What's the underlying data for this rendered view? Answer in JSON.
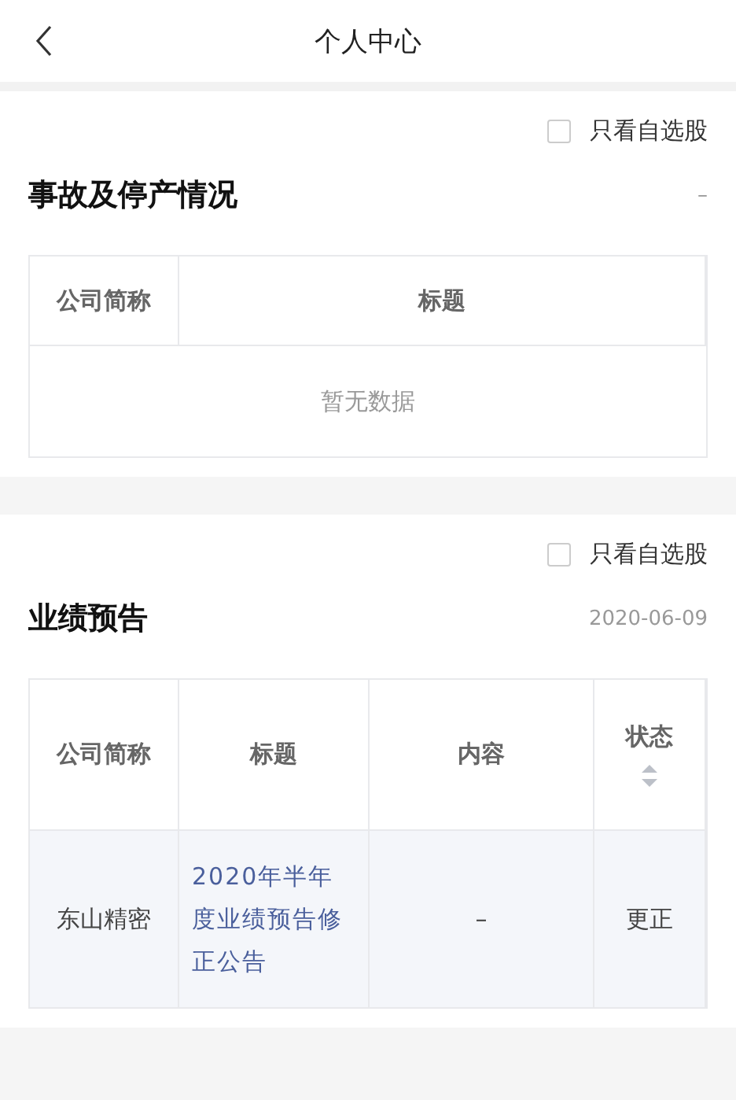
{
  "header": {
    "title": "个人中心"
  },
  "sections": [
    {
      "filter": {
        "label": "只看自选股",
        "checked": false
      },
      "title": "事故及停产情况",
      "date": "–",
      "table": {
        "columns": [
          {
            "label": "公司简称",
            "sortable": false
          },
          {
            "label": "标题",
            "sortable": false
          }
        ],
        "empty_text": "暂无数据"
      }
    },
    {
      "filter": {
        "label": "只看自选股",
        "checked": false
      },
      "title": "业绩预告",
      "date": "2020-06-09",
      "table": {
        "columns": [
          {
            "label": "公司简称",
            "sortable": false
          },
          {
            "label": "标题",
            "sortable": false
          },
          {
            "label": "内容",
            "sortable": false
          },
          {
            "label": "状态",
            "sortable": true
          }
        ],
        "rows": [
          {
            "cells": [
              {
                "text": "东山精密",
                "kind": "text"
              },
              {
                "text": "2020年半年度业绩预告修正公告",
                "kind": "link"
              },
              {
                "text": "–",
                "kind": "text"
              },
              {
                "text": "更正",
                "kind": "text"
              }
            ]
          }
        ]
      }
    }
  ]
}
